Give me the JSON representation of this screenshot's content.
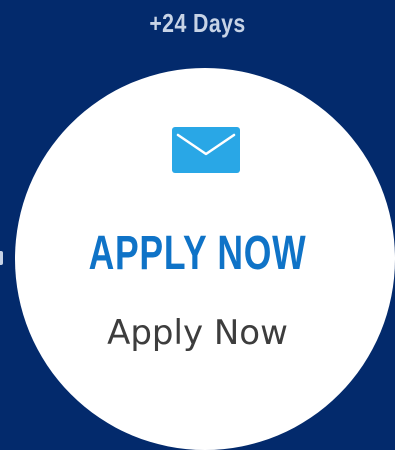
{
  "header": {
    "days_label": "+24 Days"
  },
  "card": {
    "icon": "mail-icon",
    "heading": "APPLY NOW",
    "subheading": "Apply Now"
  },
  "colors": {
    "background": "#032a6c",
    "header_text": "#c7d3e6",
    "circle": "#ffffff",
    "accent": "#0f73c7",
    "icon": "#29a7e6",
    "body_text": "#3d3d3d"
  }
}
